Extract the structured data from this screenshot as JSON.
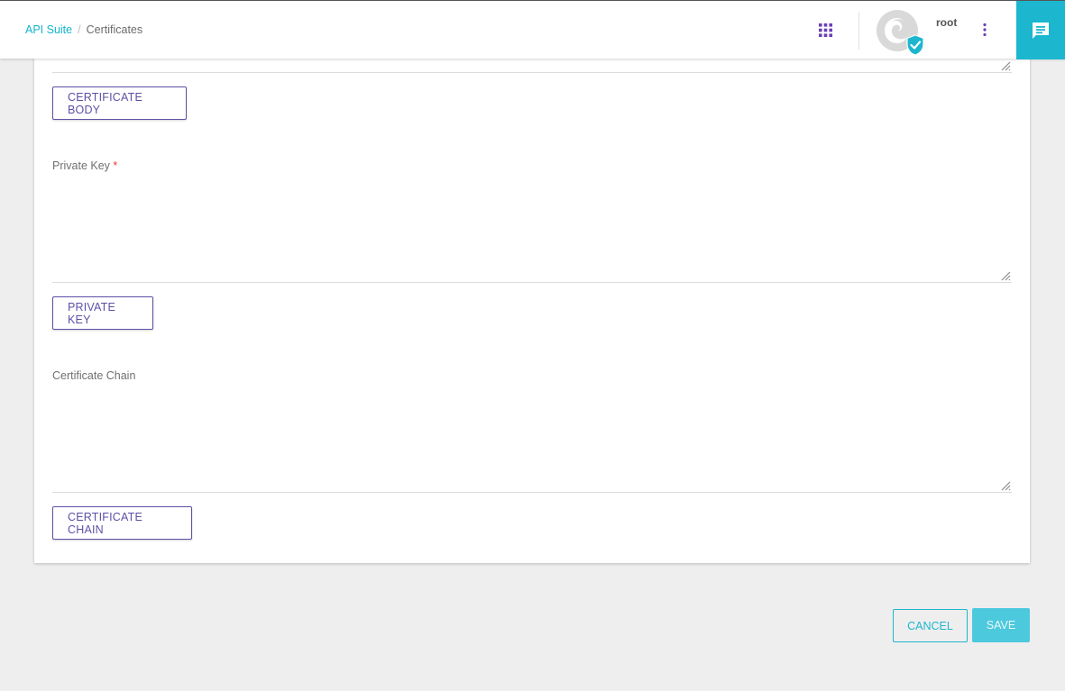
{
  "breadcrumb": {
    "root_link": "API Suite",
    "separator": "/",
    "current": "Certificates"
  },
  "header": {
    "apps_icon": "apps-grid-icon",
    "avatar_icon": "verified-user-avatar-icon",
    "username": "root",
    "more_icon": "more-vertical-icon",
    "chat_icon": "chat-icon"
  },
  "form": {
    "certificate_body": {
      "upload_label": "CERTIFICATE BODY"
    },
    "private_key": {
      "label": "Private Key",
      "required_marker": "*",
      "value": "",
      "upload_label": "PRIVATE KEY"
    },
    "certificate_chain": {
      "label": "Certificate Chain",
      "value": "",
      "upload_label": "CERTIFICATE CHAIN"
    }
  },
  "actions": {
    "cancel_label": "CANCEL",
    "save_label": "SAVE"
  },
  "colors": {
    "accent": "#1cb6cf",
    "primary_purple": "#5c51a6",
    "apps_icon": "#6a3fb8",
    "required": "#e53935",
    "background": "#eeeeee"
  }
}
